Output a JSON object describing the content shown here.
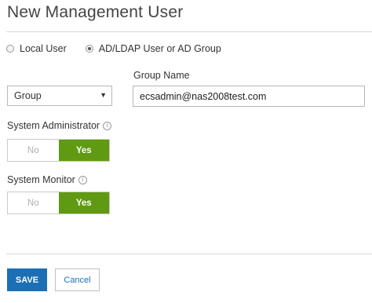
{
  "page": {
    "title": "New Management User"
  },
  "user_type": {
    "options": [
      {
        "label": "Local User",
        "checked": false
      },
      {
        "label": "AD/LDAP User or AD Group",
        "checked": true
      }
    ]
  },
  "group": {
    "type_select": {
      "value": "Group"
    },
    "name_label": "Group Name",
    "name_value": "ecsadmin@nas2008test.com"
  },
  "system_administrator": {
    "label": "System Administrator",
    "no_label": "No",
    "yes_label": "Yes",
    "selected": "Yes"
  },
  "system_monitor": {
    "label": "System Monitor",
    "no_label": "No",
    "yes_label": "Yes",
    "selected": "Yes"
  },
  "actions": {
    "save_label": "SAVE",
    "cancel_label": "Cancel"
  },
  "colors": {
    "accent_blue": "#1b6fb5",
    "toggle_on_green": "#5f9a12"
  }
}
